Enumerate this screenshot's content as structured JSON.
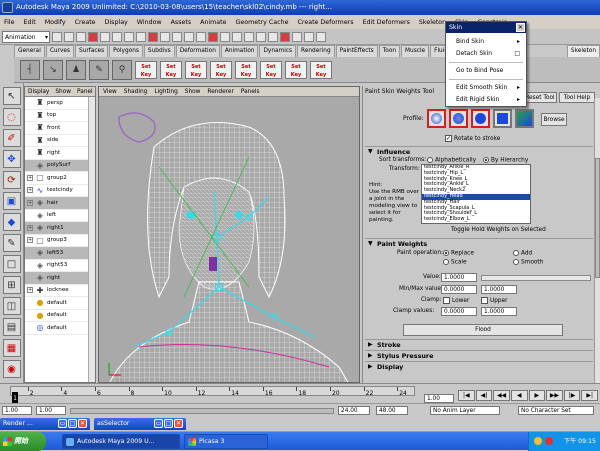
{
  "window": {
    "title": "Autodesk Maya 2009 Unlimited: C:\\2010-03-08\\users\\15\\teacher\\skl02\\cindy.mb  ---  right..."
  },
  "menubar": [
    "File",
    "Edit",
    "Modify",
    "Create",
    "Display",
    "Window",
    "Assets",
    "Animate",
    "Geometry Cache",
    "Create Deformers",
    "Edit Deformers",
    "Skeleton",
    "Skin",
    "Constrain"
  ],
  "statusline": {
    "mode": "Animation"
  },
  "shelf_tabs": [
    "General",
    "Curves",
    "Surfaces",
    "Polygons",
    "Subdivs",
    "Deformation",
    "Animation",
    "Dynamics",
    "Rendering",
    "PaintEffects",
    "Toon",
    "Muscle",
    "Fluids",
    "Fur"
  ],
  "shelf_tab_right": "Skeleton",
  "shelf_set_labels": [
    "Set Key",
    "Set Key",
    "Set Key",
    "Set Key",
    "Set Key",
    "Set Key",
    "Set Key",
    "Set Key"
  ],
  "outliner": {
    "menus": [
      "Display",
      "Show",
      "Panel"
    ],
    "items": [
      {
        "label": "persp",
        "type": "camera",
        "expand": false,
        "sel": false
      },
      {
        "label": "top",
        "type": "camera",
        "expand": false,
        "sel": false
      },
      {
        "label": "front",
        "type": "camera",
        "expand": false,
        "sel": false
      },
      {
        "label": "side",
        "type": "camera",
        "expand": false,
        "sel": false
      },
      {
        "label": "right",
        "type": "camera",
        "expand": false,
        "sel": false
      },
      {
        "label": "polySurf",
        "type": "mesh",
        "expand": false,
        "sel": true
      },
      {
        "label": "group2",
        "type": "group",
        "expand": true,
        "sel": false
      },
      {
        "label": "testcindy",
        "type": "curve",
        "expand": true,
        "sel": false
      },
      {
        "label": "hair",
        "type": "mesh",
        "expand": true,
        "sel": true
      },
      {
        "label": "left",
        "type": "mesh",
        "expand": false,
        "sel": false
      },
      {
        "label": "right1",
        "type": "mesh",
        "expand": true,
        "sel": true
      },
      {
        "label": "group3",
        "type": "group",
        "expand": true,
        "sel": false
      },
      {
        "label": "left53",
        "type": "mesh",
        "expand": false,
        "sel": true
      },
      {
        "label": "right53",
        "type": "mesh",
        "expand": false,
        "sel": false
      },
      {
        "label": "right",
        "type": "mesh",
        "expand": false,
        "sel": true
      },
      {
        "label": "locknee",
        "type": "locator",
        "expand": true,
        "sel": false
      },
      {
        "label": "default",
        "type": "light",
        "expand": false,
        "sel": false
      },
      {
        "label": "default",
        "type": "light",
        "expand": false,
        "sel": false
      },
      {
        "label": "default",
        "type": "set",
        "expand": false,
        "sel": false
      }
    ]
  },
  "viewport": {
    "menus": [
      "View",
      "Shading",
      "Lighting",
      "Show",
      "Renderer",
      "Panels"
    ]
  },
  "tool_settings": {
    "title": "Paint Skin Weights Tool",
    "reset_label": "Reset Tool",
    "help_label": "Tool Help",
    "profile_label": "Profile:",
    "browse_label": "Browse",
    "rotate_to_stroke": "Rotate to stroke",
    "sections": {
      "influence": "Influence",
      "paint_weights": "Paint Weights",
      "stroke": "Stroke",
      "stylus_pressure": "Stylus Pressure",
      "display": "Display"
    },
    "sort_transforms_label": "Sort transforms:",
    "sort_alpha": "Alphabetically",
    "sort_hier": "By Hierarchy",
    "transform_label": "Transform:",
    "influences": [
      "testcindy_Ankle_R",
      "testcindy_Hip_L",
      "testcindy_Knee_L",
      "testcindy_Ankle_L",
      "testcindy_Neck2",
      "testcindy_Head",
      "testcindy_Hair",
      "testcindy_Scapula_L",
      "testcindy_Shoulder_L",
      "testcindy_Elbow_L"
    ],
    "selected_influence": "testcindy_Head",
    "hint": "Hint:\nUse the RMB over a joint in the modeling view to select it for painting.",
    "toggle_hold": "Toggle Hold Weights on Selected",
    "paint_operation_label": "Paint operation:",
    "ops": [
      "Replace",
      "Add",
      "Scale",
      "Smooth"
    ],
    "value_label": "Value:",
    "value": "1.0000",
    "minmax_label": "Min/Max value:",
    "min_value": "0.0000",
    "max_value": "1.0000",
    "clamp_label": "Clamp:",
    "clamp_lower": "Lower",
    "clamp_upper": "Upper",
    "clamp_values_label": "Clamp values:",
    "clamp_min": "0.0000",
    "clamp_max": "1.0000",
    "flood_label": "Flood"
  },
  "skin_menu": {
    "title": "Skin",
    "items": [
      "Bind Skin",
      "Detach Skin",
      "Go to Bind Pose",
      "Edit Smooth Skin",
      "Edit Rigid Skin"
    ]
  },
  "timeline": {
    "ticks": [
      "2",
      "4",
      "6",
      "8",
      "10",
      "12",
      "14",
      "16",
      "18",
      "20",
      "22",
      "24"
    ],
    "current": "1",
    "current_field": "1.00"
  },
  "range": {
    "start": "1.00",
    "inner_start": "1.00",
    "inner_end": "24.00",
    "end": "48.00",
    "anim_layer": "No Anim Layer",
    "character_set": "No Character Set"
  },
  "mini_windows": [
    "Render ...",
    "asSelector"
  ],
  "taskbar": {
    "start_label": "開始",
    "tasks": [
      "Autodesk Maya 2009 U...",
      "Picasa 3"
    ],
    "clock": "下午 09:15"
  },
  "colors": {
    "accent": "#0a246a",
    "xp_blue": "#245edb",
    "wire": "#ffffff",
    "joint": "#3fd7e8"
  }
}
